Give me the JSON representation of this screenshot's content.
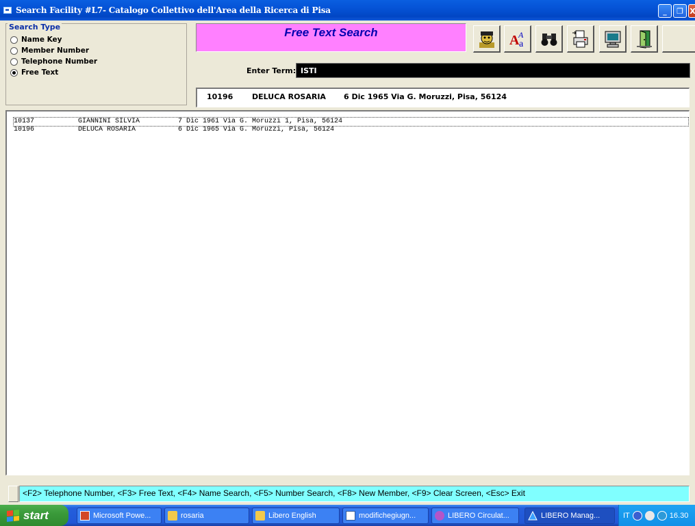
{
  "window": {
    "title": "Search Facility #L7- Catalogo Collettivo dell'Area della Ricerca di Pisa",
    "minimize": "_",
    "maximize": "❐",
    "close": "X"
  },
  "search_type": {
    "legend": "Search Type",
    "options": [
      {
        "label": "Name Key",
        "selected": false
      },
      {
        "label": "Member Number",
        "selected": false
      },
      {
        "label": "Telephone Number",
        "selected": false
      },
      {
        "label": "Free Text",
        "selected": true
      }
    ]
  },
  "mode_banner": "Free Text Search",
  "toolbar_icons": [
    "member-face-icon",
    "font-icon",
    "binoculars-icon",
    "printer-icon",
    "monitor-icon",
    "exit-door-icon"
  ],
  "enter_term": {
    "label": "Enter Term:",
    "value": "ISTI"
  },
  "selected_record": {
    "number": "10196",
    "name": "DELUCA ROSARIA",
    "details": "6 Dic 1965 Via G. Moruzzi, Pisa, 56124"
  },
  "results": [
    {
      "number": "10137",
      "name": "GIANNINI SILVIA",
      "details": "7 Dic 1961 Via G. Moruzzi 1, Pisa, 56124"
    },
    {
      "number": "10196",
      "name": "DELUCA ROSARIA",
      "details": "6 Dic 1965 Via G. Moruzzi, Pisa, 56124"
    }
  ],
  "status_bar": "<F2> Telephone Number, <F3> Free Text, <F4> Name Search, <F5> Number Search, <F8> New Member, <F9> Clear Screen, <Esc> Exit",
  "taskbar": {
    "start": "start",
    "tasks": [
      "Microsoft Powe...",
      "rosaria",
      "Libero English",
      "modifichegiugn...",
      "LIBERO Circulat...",
      "LIBERO Manag..."
    ],
    "language": "IT",
    "clock": "16.30"
  },
  "colors": {
    "banner_bg": "#ff80ff",
    "banner_text": "#0000b0",
    "status_bg": "#80ffff",
    "term_bg": "#000000",
    "titlebar": "#0553d6"
  }
}
